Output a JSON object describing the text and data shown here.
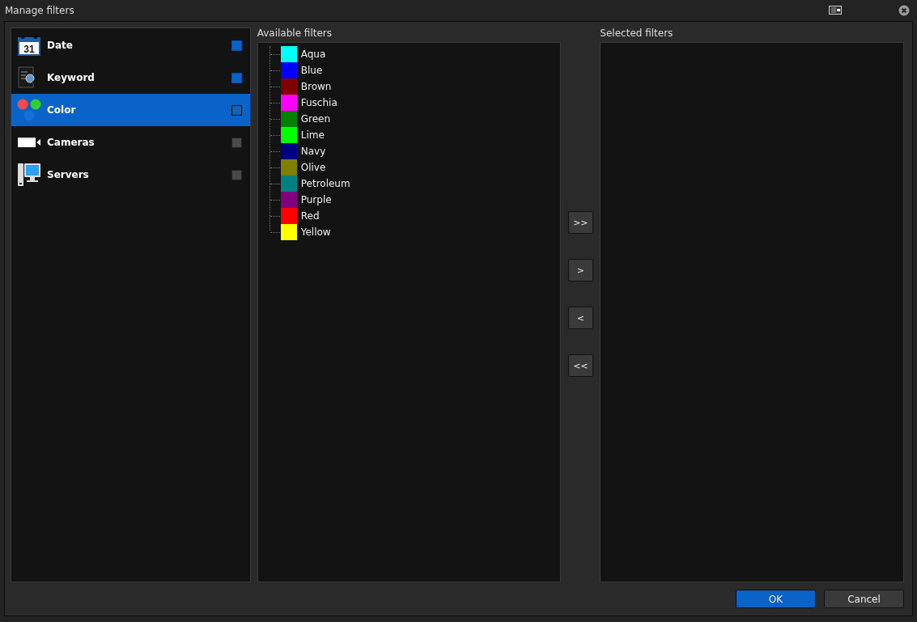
{
  "window": {
    "title": "Manage filters"
  },
  "categories": [
    {
      "kind": "date",
      "icon_text": "31",
      "label": "Date",
      "checked": true,
      "selected": false
    },
    {
      "kind": "keyword",
      "label": "Keyword",
      "checked": true,
      "selected": false
    },
    {
      "kind": "color",
      "label": "Color",
      "checked": false,
      "selected": true
    },
    {
      "kind": "cameras",
      "label": "Cameras",
      "checked": false,
      "selected": false
    },
    {
      "kind": "servers",
      "label": "Servers",
      "checked": false,
      "selected": false
    }
  ],
  "available_filters": {
    "title": "Available filters",
    "items": [
      {
        "label": "Aqua",
        "color": "#00ffff"
      },
      {
        "label": "Blue",
        "color": "#0000ff"
      },
      {
        "label": "Brown",
        "color": "#800000"
      },
      {
        "label": "Fuschia",
        "color": "#ff00ff"
      },
      {
        "label": "Green",
        "color": "#008000"
      },
      {
        "label": "Lime",
        "color": "#00ff00"
      },
      {
        "label": "Navy",
        "color": "#000080"
      },
      {
        "label": "Olive",
        "color": "#808000"
      },
      {
        "label": "Petroleum",
        "color": "#008080"
      },
      {
        "label": "Purple",
        "color": "#800080"
      },
      {
        "label": "Red",
        "color": "#ff0000"
      },
      {
        "label": "Yellow",
        "color": "#ffff00"
      }
    ]
  },
  "move_buttons": [
    ">>",
    ">",
    "<",
    "<<"
  ],
  "selected_filters": {
    "title": "Selected filters"
  },
  "buttons": [
    {
      "label": "OK",
      "kind": "primary"
    },
    {
      "label": "Cancel",
      "kind": "secondary"
    }
  ]
}
